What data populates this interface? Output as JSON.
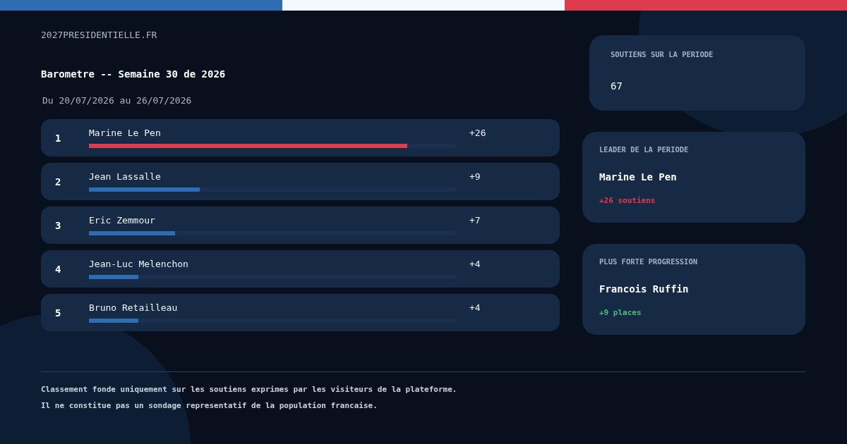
{
  "site": "2027PRESIDENTIELLE.FR",
  "title": "Barometre -- Semaine 30 de 2026",
  "period": "Du 20/07/2026 au 26/07/2026",
  "ranking": [
    {
      "rank": "1",
      "name": "Marine Le Pen",
      "delta": "+26",
      "level": 0.867,
      "color": "#dc3c4e"
    },
    {
      "rank": "2",
      "name": "Jean Lassalle",
      "delta": "+9",
      "level": 0.302,
      "color": "#2e6db4"
    },
    {
      "rank": "3",
      "name": "Eric Zemmour",
      "delta": "+7",
      "level": 0.235,
      "color": "#2e6db4"
    },
    {
      "rank": "4",
      "name": "Jean-Luc Melenchon",
      "delta": "+4",
      "level": 0.135,
      "color": "#2e6db4"
    },
    {
      "rank": "5",
      "name": "Bruno Retailleau",
      "delta": "+4",
      "level": 0.135,
      "color": "#2e6db4"
    }
  ],
  "cards": [
    {
      "kind": "count",
      "label": "SOUTIENS SUR LA PERIODE",
      "value": "67"
    },
    {
      "kind": "leader",
      "label": "LEADER DE LA PERIODE",
      "value": "Marine Le Pen",
      "note": "+26 soutiens",
      "color": "#dc3c4e"
    },
    {
      "kind": "progress",
      "label": "PLUS FORTE PROGRESSION",
      "value": "Francois Ruffin",
      "note": "+9 places",
      "color": "#4cbb78"
    }
  ],
  "footer": [
    "Classement fonde uniquement sur les soutiens exprimes par les visiteurs de la plateforme.",
    "Il ne constitue pas un sondage representatif de la population francaise."
  ]
}
